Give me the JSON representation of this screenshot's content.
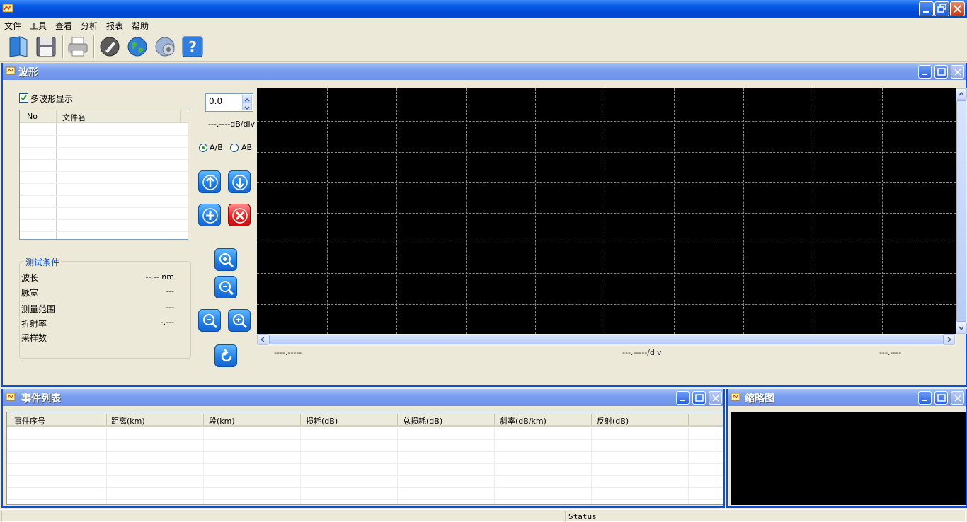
{
  "menu": [
    "文件",
    "工具",
    "查看",
    "分析",
    "报表",
    "帮助"
  ],
  "toolbar": [
    "open-icon",
    "save-icon",
    "print-icon",
    "edit-icon",
    "globe-icon",
    "settings-globe-icon",
    "help-icon"
  ],
  "waveform": {
    "title": "波形",
    "multi_wave_label": "多波形显示",
    "multi_wave_checked": true,
    "file_list": {
      "col_no": "No",
      "col_name": "文件名"
    },
    "spin_value": "0.0",
    "db_div": "---.----dB/div",
    "radio_ab_slash": "A/B",
    "radio_ab": "AB",
    "radio_selected": "A/B",
    "conditions": {
      "legend": "测试条件",
      "wavelength_label": "波长",
      "wavelength_value": "--.-- nm",
      "pulse_label": "脉宽",
      "pulse_value": "---",
      "range_label": "测量范围",
      "range_value": "---",
      "index_label": "折射率",
      "index_value": "-.---",
      "samples_label": "采样数"
    },
    "x_left": "----.-----",
    "x_mid": "---.-----/div",
    "x_right": "---.----"
  },
  "events": {
    "title": "事件列表",
    "columns": [
      "事件序号",
      "距离(km)",
      "段(km)",
      "损耗(dB)",
      "总损耗(dB)",
      "斜率(dB/km)",
      "反射(dB)"
    ]
  },
  "thumbnail": {
    "title": "缩略图"
  },
  "status": {
    "text": "Status"
  },
  "colors": {
    "title_blue": "#0a5ee8",
    "child_title": "#7a9ff0",
    "plot_bg": "#000000",
    "grid": "#8a8a8a"
  }
}
